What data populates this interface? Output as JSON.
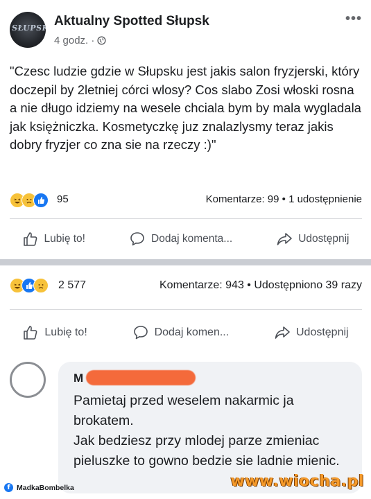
{
  "post": {
    "page_name": "Aktualny Spotted Słupsk",
    "avatar_logo_text": "SŁUPSK",
    "time": "4 godz. ·",
    "text": "\"Czesc ludzie gdzie w Słupsku jest jakis salon fryzjerski, który doczepil by 2letniej córci wlosy? Cos slabo Zosi włoski rosna a nie długo idziemy na wesele chciala bym by mala wygladala jak księżniczka. Kosmetyczkę juz znalazlysmy teraz jakis dobry fryzjer co zna sie na rzeczy :)\"",
    "reaction_count": "95",
    "reactions": [
      "haha-icon",
      "sad-icon",
      "like-icon"
    ],
    "comments_shares": "Komentarze: 99 • 1 udostępnienie"
  },
  "actions_1": {
    "like": "Lubię to!",
    "comment": "Dodaj komenta...",
    "share": "Udostępnij"
  },
  "stats_2": {
    "reaction_count": "2 577",
    "reactions": [
      "haha-icon",
      "like-icon",
      "sad-icon"
    ],
    "comments_shares": "Komentarze: 943 • Udostępniono 39 razy"
  },
  "actions_2": {
    "like": "Lubię to!",
    "comment": "Dodaj komen...",
    "share": "Udostępnij"
  },
  "comment": {
    "author_initial": "M",
    "text": "Pamietaj przed weselem nakarmic ja brokatem.\nJak bedziesz przy mlodej parze zmieniac pieluszke to gowno bedzie sie ladnie mienic."
  },
  "watermarks": {
    "left": "MadkaBombelka",
    "right": "www.wiocha.pl"
  },
  "colors": {
    "facebook_blue": "#1877f2",
    "reaction_yellow": "#f7c23a",
    "redaction_orange": "#f46a3b",
    "wiocha_orange": "#f59a2a"
  }
}
